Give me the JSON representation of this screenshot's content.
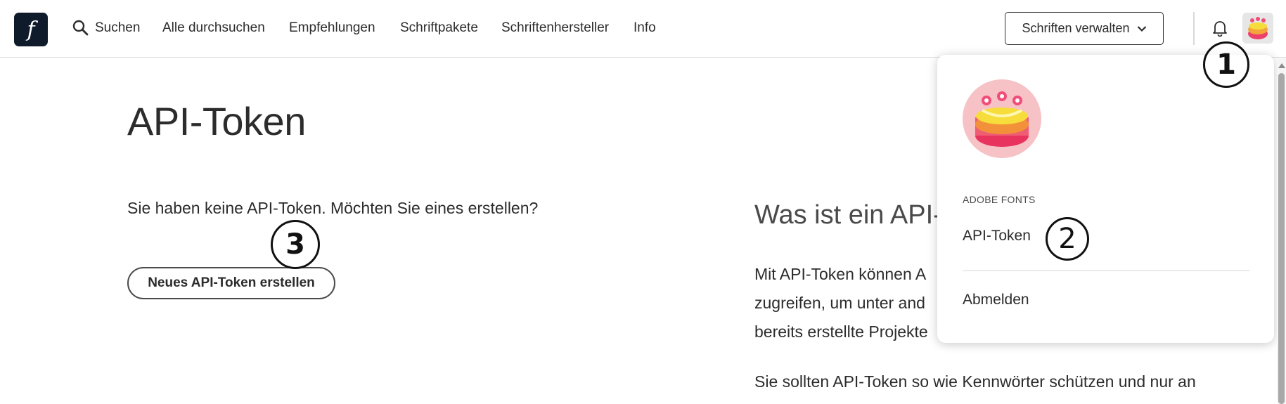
{
  "header": {
    "logo_letter": "f",
    "nav": {
      "search": "Suchen",
      "browse_all": "Alle durchsuchen",
      "recommendations": "Empfehlungen",
      "font_packs": "Schriftpakete",
      "foundries": "Schriftenhersteller",
      "info": "Info"
    },
    "manage_fonts_label": "Schriften verwalten"
  },
  "main": {
    "title": "API-Token",
    "no_tokens_text": "Sie haben keine API-Token. Möchten Sie eines erstellen?",
    "create_button_label": "Neues API-Token erstellen",
    "side_heading": "Was ist ein API-T",
    "side_lines": [
      "Mit API-Token können A",
      "zugreifen, um unter and",
      "bereits erstellte Projekte",
      "Sie sollten API-Token so wie Kennwörter schützen und nur an"
    ]
  },
  "dropdown": {
    "section_label": "ADOBE FONTS",
    "api_token_label": "API-Token",
    "sign_out_label": "Abmelden"
  },
  "annotations": {
    "marker_1": "1",
    "marker_2": "2",
    "marker_3": "3"
  },
  "icons": {
    "search": "search-icon",
    "chevron": "chevron-down-icon",
    "bell": "bell-icon"
  },
  "colors": {
    "logo_bg": "#0f1a2b",
    "text": "#2c2c2c",
    "avatar_pink": "#f7c2c6"
  }
}
